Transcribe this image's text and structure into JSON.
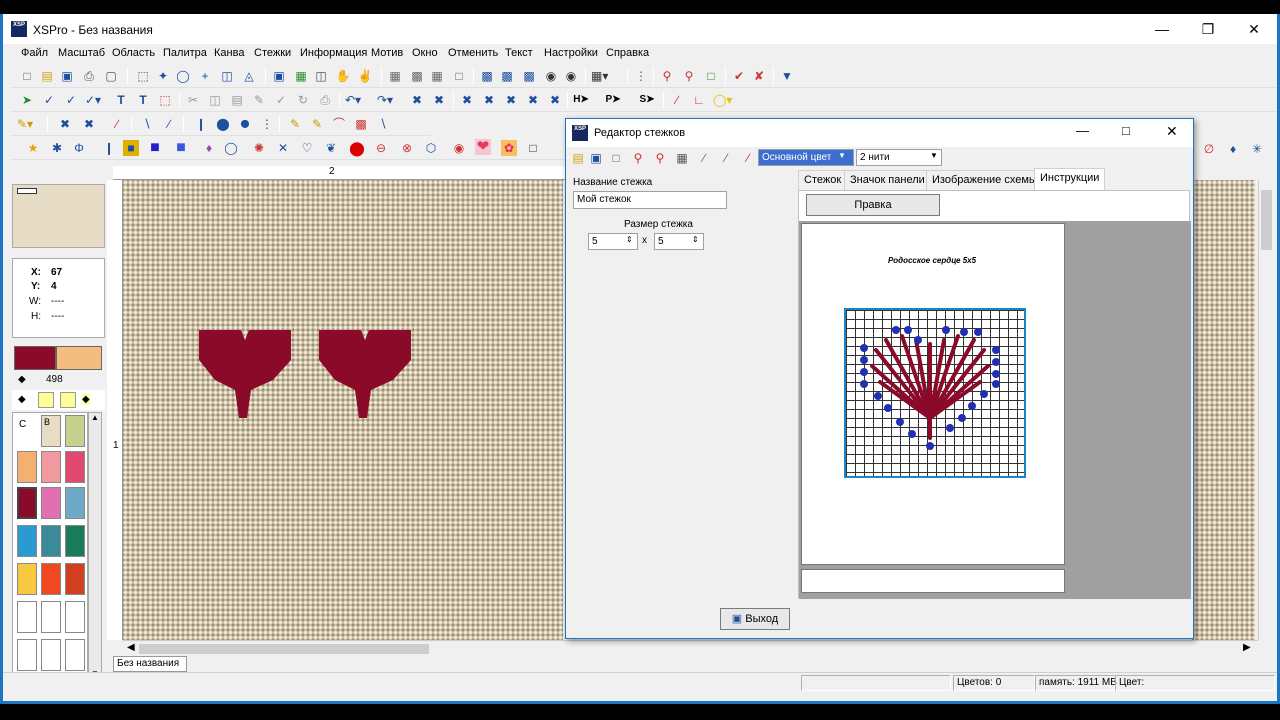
{
  "app": {
    "title": "XSPro - Без названия",
    "icon_text": "XSP"
  },
  "menu": [
    "Файл",
    "Масштаб",
    "Область",
    "Палитра",
    "Канва",
    "Стежки",
    "Информация",
    "Мотив",
    "Окно",
    "Отменить",
    "Текст",
    "Настройки",
    "Справка"
  ],
  "coords": {
    "x_label": "X:",
    "x_val": "67",
    "y_label": "Y:",
    "y_val": "4",
    "w_label": "W:",
    "w_val": "----",
    "h_label": "H:",
    "h_val": "----"
  },
  "palette": {
    "count": "498",
    "col_c": "C",
    "col_b": "B",
    "accent": "#8b0a2a"
  },
  "ruler": {
    "top_mark": "2",
    "left_mark": "1"
  },
  "doc_tab": "Без названия",
  "dialog": {
    "title": "Редактор стежков",
    "color_select": "Основной цвет",
    "threads_select": "2 нити",
    "name_label": "Название стежка",
    "name_value": "Мой стежок",
    "size_label": "Размер стежка",
    "size_w": "5",
    "size_x": "x",
    "size_h": "5",
    "tabs": [
      "Стежок",
      "Значок панели",
      "Изображение схемы",
      "Инструкции"
    ],
    "active_tab": "Инструкции",
    "edit_button": "Правка",
    "preview_caption": "Родосское сердце 5х5",
    "exit_button": "Выход"
  },
  "status": {
    "colors": "Цветов: 0",
    "memory": "память: 1911 MB",
    "color": "Цвет:"
  }
}
